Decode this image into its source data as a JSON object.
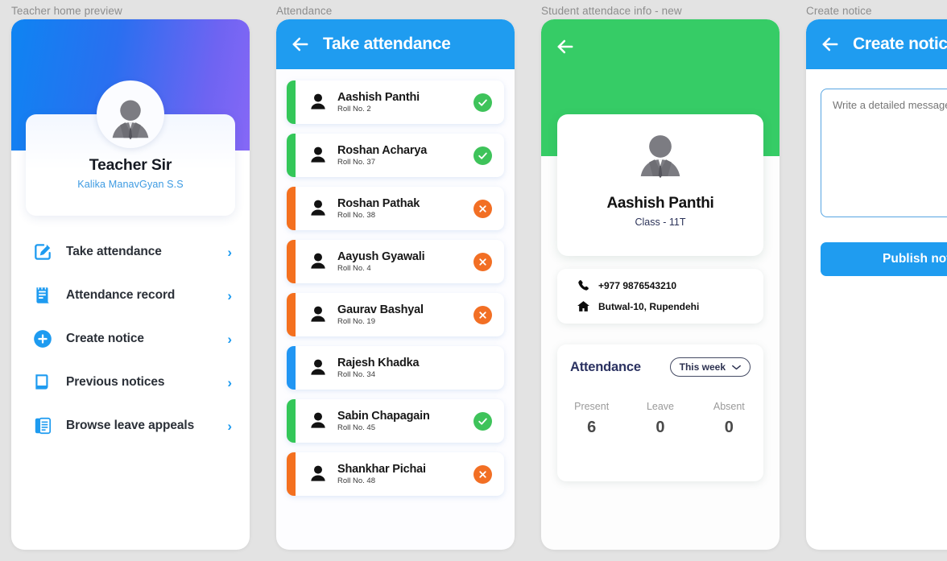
{
  "panels": {
    "home": {
      "caption": "Teacher home preview",
      "teacher_name": "Teacher Sir",
      "school_name": "Kalika ManavGyan S.S",
      "avatar_icon": "person-avatar-icon",
      "menu": [
        {
          "label": "Take attendance",
          "icon": "edit-square-icon",
          "chevron": "›"
        },
        {
          "label": "Attendance record",
          "icon": "receipt-list-icon",
          "chevron": "›"
        },
        {
          "label": "Create notice",
          "icon": "plus-circle-icon",
          "chevron": "›"
        },
        {
          "label": "Previous notices",
          "icon": "document-icon",
          "chevron": "›"
        },
        {
          "label": "Browse leave appeals",
          "icon": "list-card-icon",
          "chevron": "›"
        }
      ]
    },
    "attendance": {
      "caption": "Attendance",
      "title": "Take attendance",
      "back_icon": "back-arrow-icon",
      "students": [
        {
          "name": "Aashish Panthi",
          "roll": "Roll No. 2",
          "status": "present",
          "stripe": "#34c759",
          "badge": "#3ec35a",
          "badge_icon": "check-icon"
        },
        {
          "name": "Roshan Acharya",
          "roll": "Roll No. 37",
          "status": "present",
          "stripe": "#34c759",
          "badge": "#3ec35a",
          "badge_icon": "check-icon"
        },
        {
          "name": "Roshan Pathak",
          "roll": "Roll No. 38",
          "status": "absent",
          "stripe": "#f4701f",
          "badge": "#f26f24",
          "badge_icon": "cross-icon"
        },
        {
          "name": "Aayush Gyawali",
          "roll": "Roll No. 4",
          "status": "absent",
          "stripe": "#f4701f",
          "badge": "#f26f24",
          "badge_icon": "cross-icon"
        },
        {
          "name": "Gaurav Bashyal",
          "roll": "Roll No. 19",
          "status": "absent",
          "stripe": "#f4701f",
          "badge": "#f26f24",
          "badge_icon": "cross-icon"
        },
        {
          "name": "Rajesh Khadka",
          "roll": "Roll No. 34",
          "status": "none",
          "stripe": "#2196f3",
          "badge": "",
          "badge_icon": ""
        },
        {
          "name": "Sabin Chapagain",
          "roll": "Roll No. 45",
          "status": "present",
          "stripe": "#34c759",
          "badge": "#3ec35a",
          "badge_icon": "check-icon"
        },
        {
          "name": "Shankhar Pichai",
          "roll": "Roll No. 48",
          "status": "absent",
          "stripe": "#f4701f",
          "badge": "#f26f24",
          "badge_icon": "cross-icon"
        }
      ]
    },
    "student_info": {
      "caption": "Student attendace info - new",
      "back_icon": "back-arrow-icon",
      "student_name": "Aashish Panthi",
      "student_class": "Class - 11T",
      "phone": "+977 9876543210",
      "phone_icon": "phone-icon",
      "address": "Butwal-10, Rupendehi",
      "address_icon": "home-icon",
      "attendance_title": "Attendance",
      "range_label": "This week",
      "range_icon": "chevron-down-icon",
      "stats": [
        {
          "label": "Present",
          "value": "6"
        },
        {
          "label": "Leave",
          "value": "0"
        },
        {
          "label": "Absent",
          "value": "0"
        }
      ]
    },
    "create_notice": {
      "caption": "Create notice",
      "title": "Create notice",
      "back_icon": "back-arrow-icon",
      "message_placeholder": "Write a detailed message",
      "message_value": "",
      "publish_label": "Publish notice"
    }
  },
  "colors": {
    "background": "#e3e3e3",
    "blue_header": "#1f9cf0",
    "green_header": "#36cc66",
    "present_green": "#3ec35a",
    "absent_orange": "#f26f24",
    "accent_blue": "#1e9bf0",
    "caption_gray": "#8d8d8d"
  }
}
